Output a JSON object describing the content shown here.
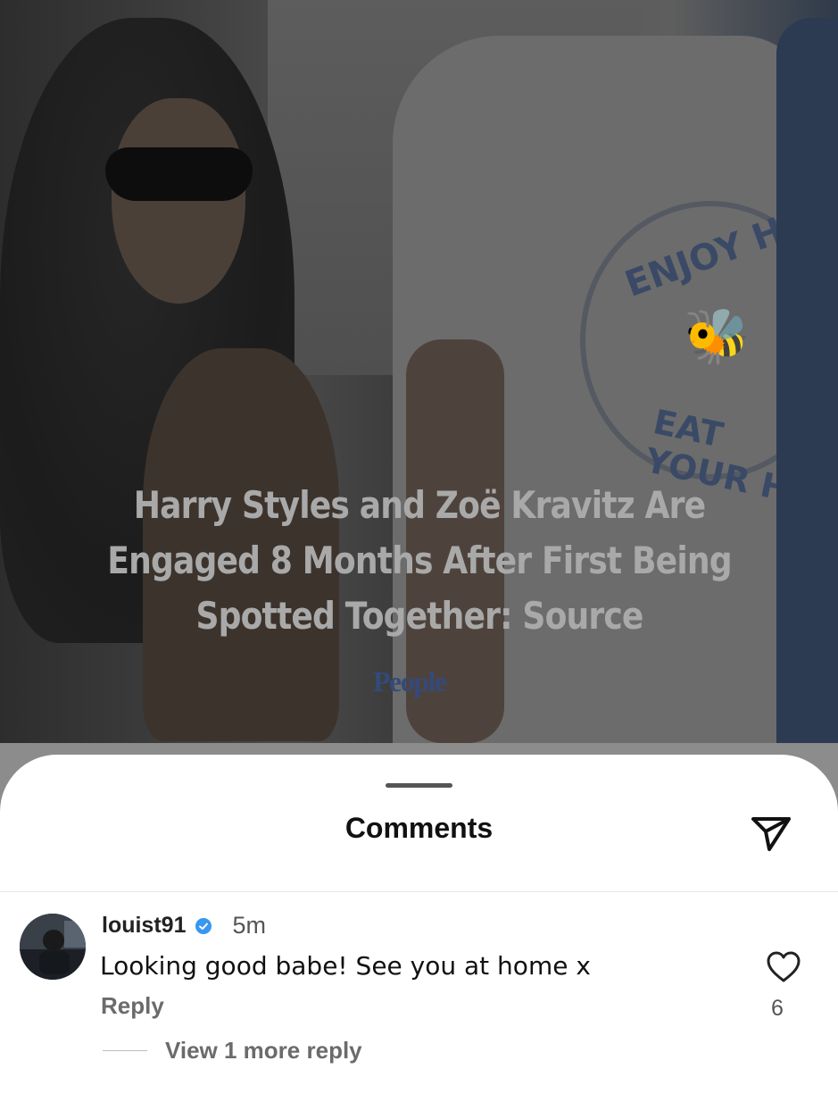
{
  "post": {
    "headline_lines": [
      "Harry Styles and Zoë Kravitz Are",
      "Engaged 8 Months After First Being",
      "Spotted Together: Source"
    ],
    "brand": "People",
    "shirt_print_top": "ENJOY HE",
    "shirt_print_bottom": "EAT YOUR H"
  },
  "comments_sheet": {
    "title": "Comments",
    "share_icon": "send-icon",
    "comments": [
      {
        "username": "louist91",
        "verified": true,
        "time": "5m",
        "text": "Looking good babe! See you at home x",
        "reply_label": "Reply",
        "likes": "6",
        "view_replies_label": "View 1 more reply"
      }
    ]
  },
  "colors": {
    "sheet_bg": "#ffffff",
    "verified": "#3897f0",
    "brand": "#344a7a"
  }
}
